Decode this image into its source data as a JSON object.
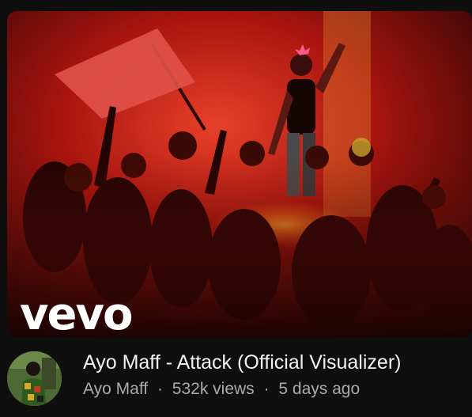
{
  "thumbnail": {
    "watermark": "vevo",
    "colors": {
      "background": "#0f0f0f",
      "scene_red": "#c81e12",
      "flag": "#e0524a",
      "text_primary": "#f1f1f1",
      "text_secondary": "#aaaaaa"
    }
  },
  "video": {
    "title": "Ayo Maff - Attack (Official Visualizer)",
    "channel": "Ayo Maff",
    "separator": "·",
    "views": "532k views",
    "age": "5 days ago"
  }
}
